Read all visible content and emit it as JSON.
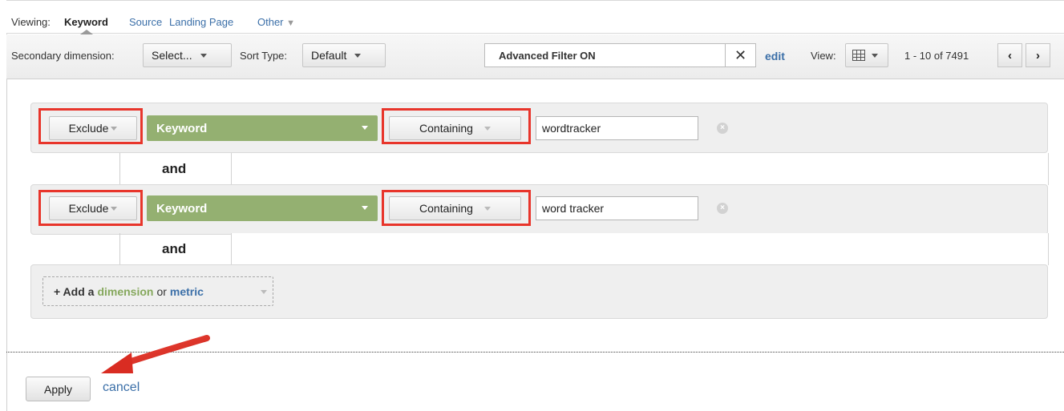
{
  "viewing": {
    "label": "Viewing:",
    "active": "Keyword",
    "links": [
      "Source",
      "Landing Page",
      "Other"
    ]
  },
  "toolbar": {
    "secondary_label": "Secondary dimension:",
    "secondary_value": "Select...",
    "sort_label": "Sort Type:",
    "sort_value": "Default",
    "filter_status": "Advanced Filter ON",
    "filter_clear": "✕",
    "edit_label": "edit",
    "view_label": "View:",
    "pagination": "1 - 10 of 7491",
    "prev_label": "‹",
    "next_label": "›"
  },
  "filters": [
    {
      "mode": "Exclude",
      "dimension": "Keyword",
      "match": "Containing",
      "value": "wordtracker"
    },
    {
      "mode": "Exclude",
      "dimension": "Keyword",
      "match": "Containing",
      "value": "word tracker"
    }
  ],
  "connector": "and",
  "add": {
    "prefix": "+ Add a",
    "dimension": "dimension",
    "or": "or",
    "metric": "metric"
  },
  "actions": {
    "apply": "Apply",
    "cancel": "cancel"
  },
  "colors": {
    "link": "#3b6fa8",
    "dimension_green": "#94b071",
    "highlight_red": "#e8352b"
  },
  "icons": [
    "caret-up-icon",
    "close-icon",
    "grid-icon",
    "chevron-left-icon",
    "chevron-right-icon",
    "remove-icon",
    "arrow-annotation-icon"
  ]
}
